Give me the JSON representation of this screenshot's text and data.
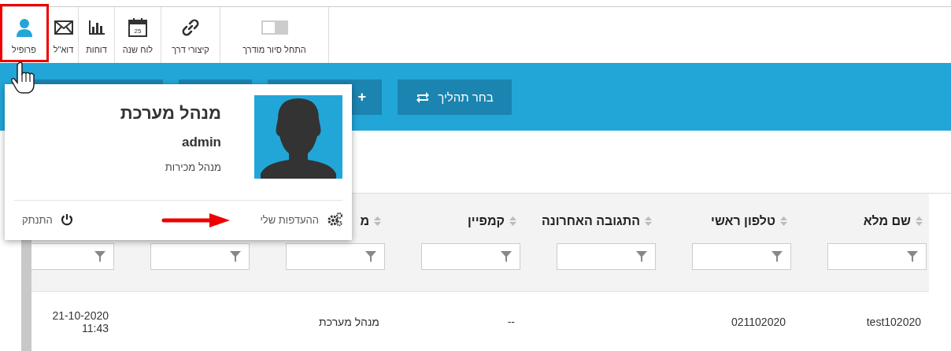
{
  "toolbar": {
    "items": [
      {
        "kind": "toggle",
        "label": "התחל סיור מודרך",
        "on": false,
        "highlighted": false
      },
      {
        "kind": "shortcuts",
        "label": "קיצורי דרך",
        "highlighted": false
      },
      {
        "kind": "calendar",
        "label": "לוח שנה",
        "day": "25",
        "highlighted": false
      },
      {
        "kind": "reports",
        "label": "דוחות",
        "highlighted": false
      },
      {
        "kind": "mail",
        "label": "דוא\"ל",
        "highlighted": false
      },
      {
        "kind": "profile",
        "label": "פרופיל",
        "highlighted": true
      }
    ]
  },
  "action_bar": {
    "buttons": [
      {
        "kind": "process",
        "label": "בחר תהליך"
      },
      {
        "kind": "add",
        "label": "+"
      },
      {
        "kind": "blank"
      },
      {
        "kind": "blank"
      }
    ]
  },
  "profile_popup": {
    "name": "מנהל מערכת",
    "username": "admin",
    "role": "מנהל מכירות",
    "links": [
      {
        "kind": "preferences",
        "label": "ההעדפות שלי"
      },
      {
        "kind": "logout",
        "label": "התנתק"
      }
    ]
  },
  "table": {
    "columns": [
      {
        "label": "שם מלא"
      },
      {
        "label": "טלפון ראשי"
      },
      {
        "label": "התגובה האחרונה"
      },
      {
        "label": "קמפיין"
      },
      {
        "label": "מ"
      },
      {},
      {}
    ],
    "rows": [
      {
        "cells": [
          {
            "text": "test102020"
          },
          {
            "text": "021102020"
          },
          {},
          {
            "text": "--"
          },
          {
            "text": "מנהל מערכת"
          },
          {},
          {
            "text": "21-10-2020 11:43"
          }
        ]
      }
    ]
  }
}
